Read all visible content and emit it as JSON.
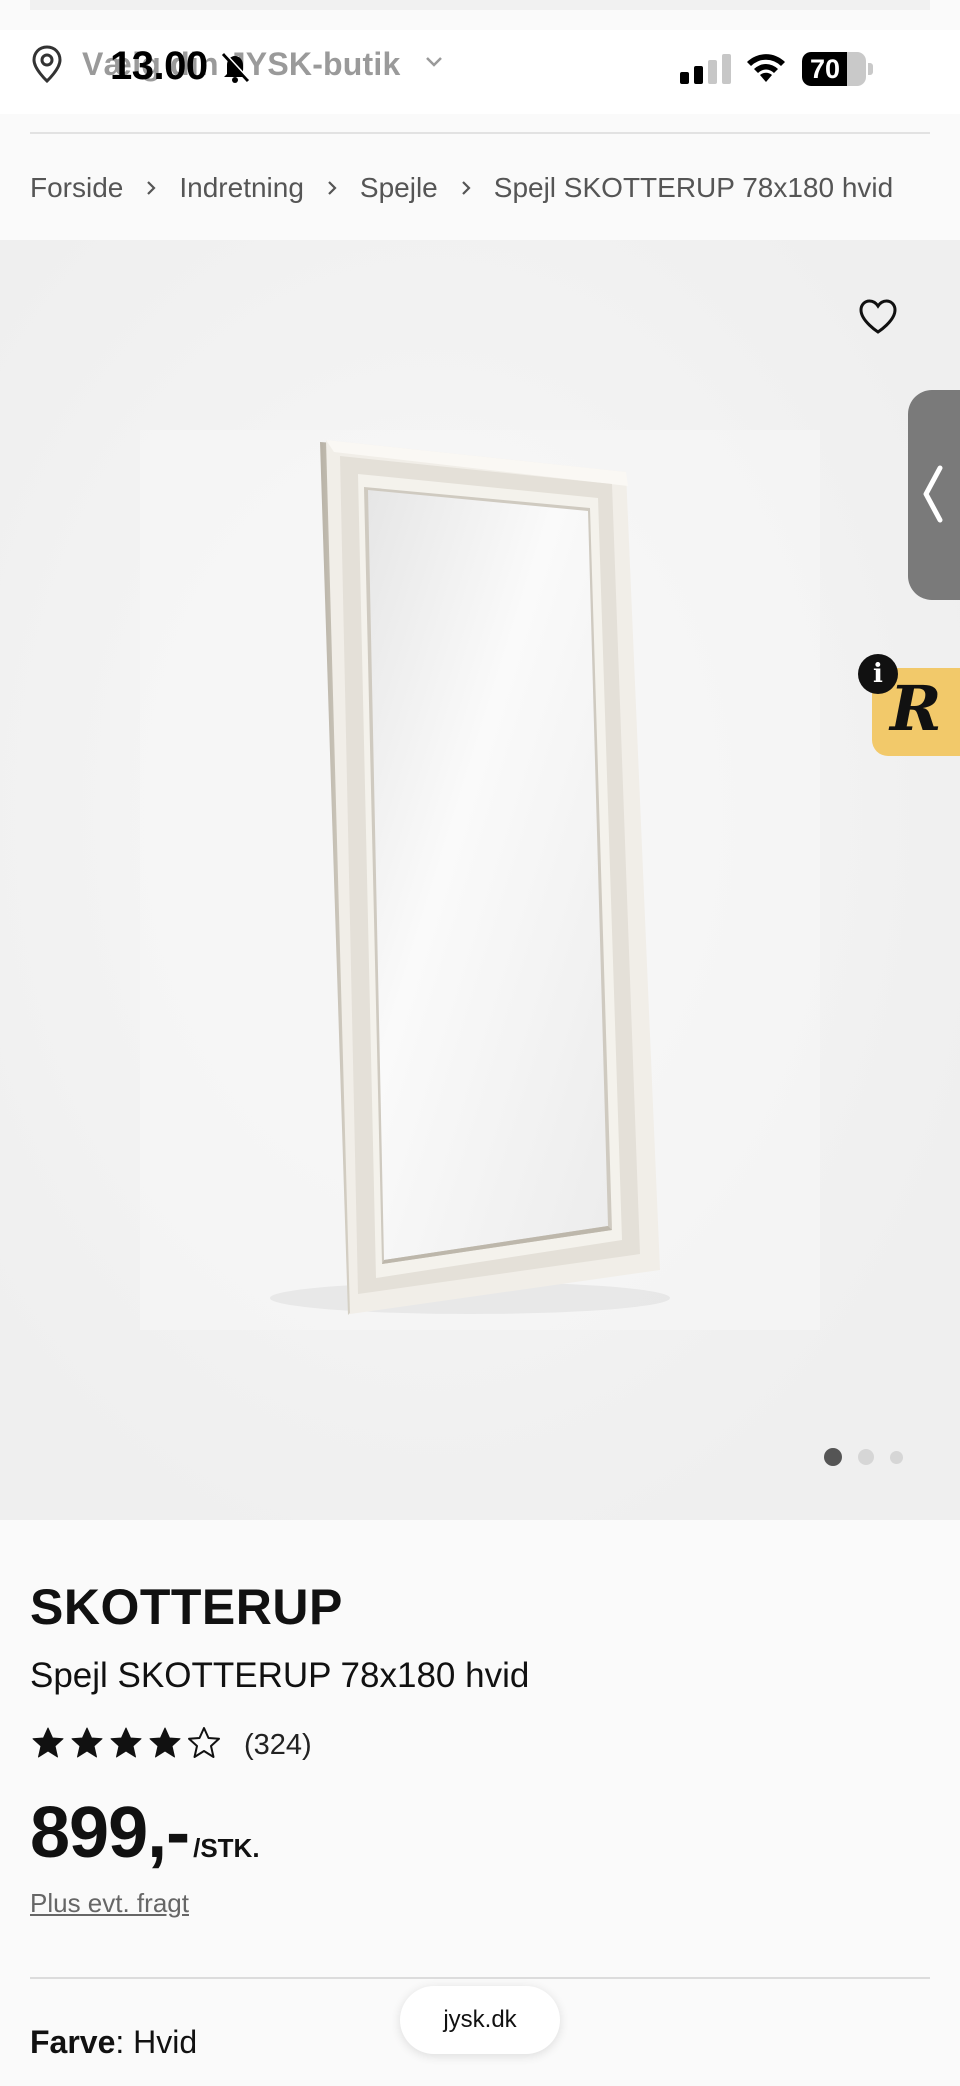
{
  "status_bar": {
    "time": "13.00",
    "battery": "70",
    "battery_level": 0.7
  },
  "header": {
    "store_label": "Vælg din JYSK-butik"
  },
  "breadcrumb": {
    "items": [
      "Forside",
      "Indretning",
      "Spejle",
      "Spejl SKOTTERUP 78x180 hvid"
    ]
  },
  "gallery": {
    "image_alt": "Spejl SKOTTERUP 78x180 hvid",
    "current_slide": 1,
    "total_slides": 3
  },
  "side_badge": {
    "info": "i",
    "letter": "R"
  },
  "product": {
    "brand": "SKOTTERUP",
    "name": "Spejl SKOTTERUP 78x180 hvid",
    "rating": 4,
    "rating_max": 5,
    "review_count": "(324)",
    "price": "899,-",
    "unit": "/STK.",
    "shipping_note": "Plus evt. fragt",
    "color_label": "Farve",
    "color_value": "Hvid"
  },
  "browser": {
    "url": "jysk.dk"
  },
  "colors": {
    "page_bg": "#fafafa",
    "gallery_bg": "#f3f3f3",
    "badge_yellow": "#f2c96a",
    "side_tab_gray": "#7a7a7a"
  }
}
